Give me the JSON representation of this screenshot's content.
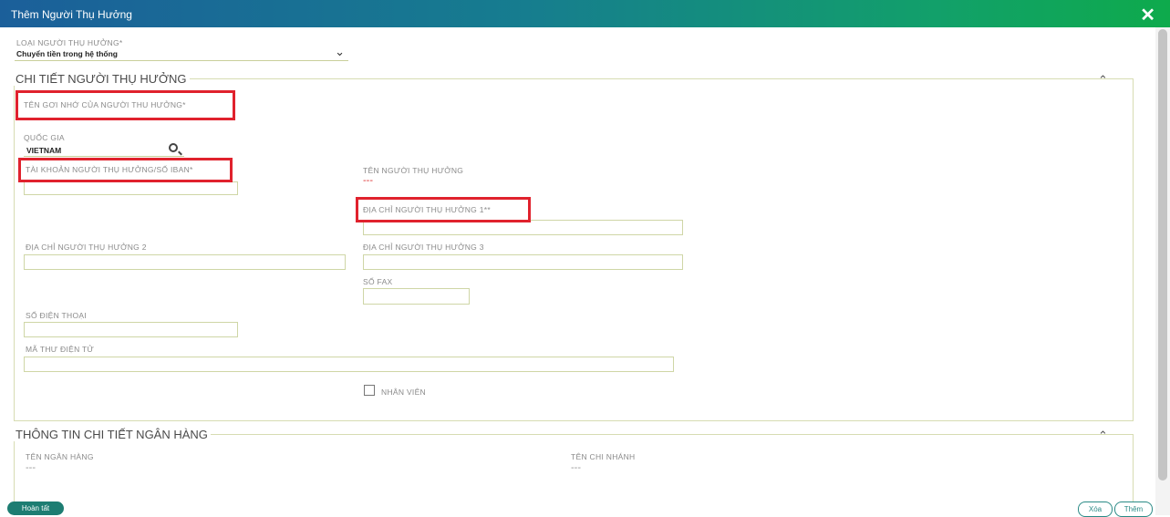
{
  "dialog": {
    "title": "Thêm Người Thụ Hưởng",
    "close_icon": "✕"
  },
  "beneficiary_type": {
    "label": "LOẠI NGƯỜI THỤ HƯỞNG*",
    "value": "Chuyển tiền trong hệ thống"
  },
  "details": {
    "title": "CHI TIẾT NGƯỜI THỤ HƯỞNG",
    "nickname_label": "TÊN GỢI NHỚ CỦA NGƯỜI THỤ HƯỞNG*",
    "country_label": "QUỐC GIA",
    "country_value": "VIETNAM",
    "account_label": "TÀI KHOẢN NGƯỜI THỤ HƯỞNG/SỐ IBAN*",
    "beneficiary_name_label": "TÊN NGƯỜI THỤ HƯỞNG",
    "beneficiary_name_value": "---",
    "address1_label": "ĐỊA CHỈ NGƯỜI THỤ HƯỞNG 1**",
    "address2_label": "ĐỊA CHỈ NGƯỜI THỤ HƯỞNG 2",
    "address3_label": "ĐỊA CHỈ NGƯỜI THỤ HƯỞNG 3",
    "fax_label": "SỐ FAX",
    "phone_label": "SỐ ĐIỆN THOẠI",
    "email_label": "MÃ THƯ ĐIỆN TỬ",
    "employee_label": "NHÂN VIÊN"
  },
  "bank": {
    "title": "THÔNG TIN CHI TIẾT NGÂN HÀNG",
    "bank_name_label": "TÊN NGÂN HÀNG",
    "bank_name_value": "---",
    "branch_label": "TÊN CHI NHÁNH",
    "branch_value": "---"
  },
  "footer": {
    "done": "Hoàn tất",
    "delete": "Xóa",
    "save": "Thêm"
  },
  "colors": {
    "highlight": "#e0222d",
    "accent": "#1d7d72"
  }
}
